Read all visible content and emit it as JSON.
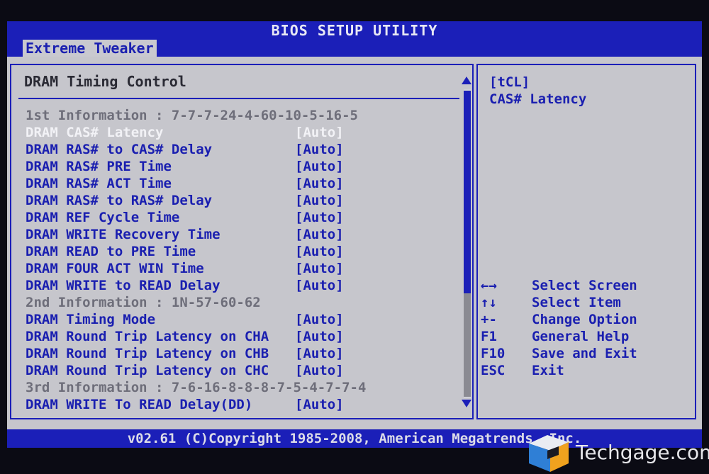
{
  "window": {
    "title": "BIOS SETUP UTILITY"
  },
  "menubar": {
    "active_tab": "Extreme Tweaker"
  },
  "section": {
    "title": "DRAM Timing Control"
  },
  "rows": [
    {
      "label": "1st Information : 7-7-7-24-4-60-10-5-16-5",
      "value": "",
      "kind": "info"
    },
    {
      "label": "DRAM CAS# Latency",
      "value": "[Auto]",
      "kind": "selected"
    },
    {
      "label": "DRAM RAS# to CAS# Delay",
      "value": "[Auto]",
      "kind": "setting"
    },
    {
      "label": "DRAM RAS# PRE Time",
      "value": "[Auto]",
      "kind": "setting"
    },
    {
      "label": "DRAM RAS# ACT Time",
      "value": "[Auto]",
      "kind": "setting"
    },
    {
      "label": "DRAM RAS# to RAS# Delay",
      "value": "[Auto]",
      "kind": "setting"
    },
    {
      "label": "DRAM REF Cycle Time",
      "value": "[Auto]",
      "kind": "setting"
    },
    {
      "label": "DRAM WRITE Recovery Time",
      "value": "[Auto]",
      "kind": "setting"
    },
    {
      "label": "DRAM READ to PRE Time",
      "value": "[Auto]",
      "kind": "setting"
    },
    {
      "label": "DRAM FOUR ACT WIN Time",
      "value": "[Auto]",
      "kind": "setting"
    },
    {
      "label": "DRAM WRITE to READ Delay",
      "value": "[Auto]",
      "kind": "setting"
    },
    {
      "label": "2nd Information : 1N-57-60-62",
      "value": "",
      "kind": "info"
    },
    {
      "label": "DRAM Timing Mode",
      "value": "[Auto]",
      "kind": "setting"
    },
    {
      "label": "DRAM Round Trip Latency on CHA",
      "value": "[Auto]",
      "kind": "setting"
    },
    {
      "label": "DRAM Round Trip Latency on CHB",
      "value": "[Auto]",
      "kind": "setting"
    },
    {
      "label": "DRAM Round Trip Latency on CHC",
      "value": "[Auto]",
      "kind": "setting"
    },
    {
      "label": "3rd Information : 7-6-16-8-8-8-7-5-4-7-7-4",
      "value": "",
      "kind": "info"
    },
    {
      "label": "DRAM WRITE To READ Delay(DD)",
      "value": "[Auto]",
      "kind": "setting"
    }
  ],
  "help": {
    "line1": "[tCL]",
    "line2": "CAS# Latency"
  },
  "keys": [
    {
      "key": "←→",
      "desc": "Select Screen"
    },
    {
      "key": "↑↓",
      "desc": "Select Item"
    },
    {
      "key": "+-",
      "desc": "Change Option"
    },
    {
      "key": "F1",
      "desc": "General Help"
    },
    {
      "key": "F10",
      "desc": "Save and Exit"
    },
    {
      "key": "ESC",
      "desc": "Exit"
    }
  ],
  "footer": {
    "text": "v02.61 (C)Copyright 1985-2008, American Megatrends, Inc."
  },
  "watermark": {
    "text": "Techgage.com"
  },
  "colors": {
    "bios_blue": "#1b1fb8",
    "panel_gray": "#c6c6cc",
    "info_gray": "#6e6e7a"
  }
}
